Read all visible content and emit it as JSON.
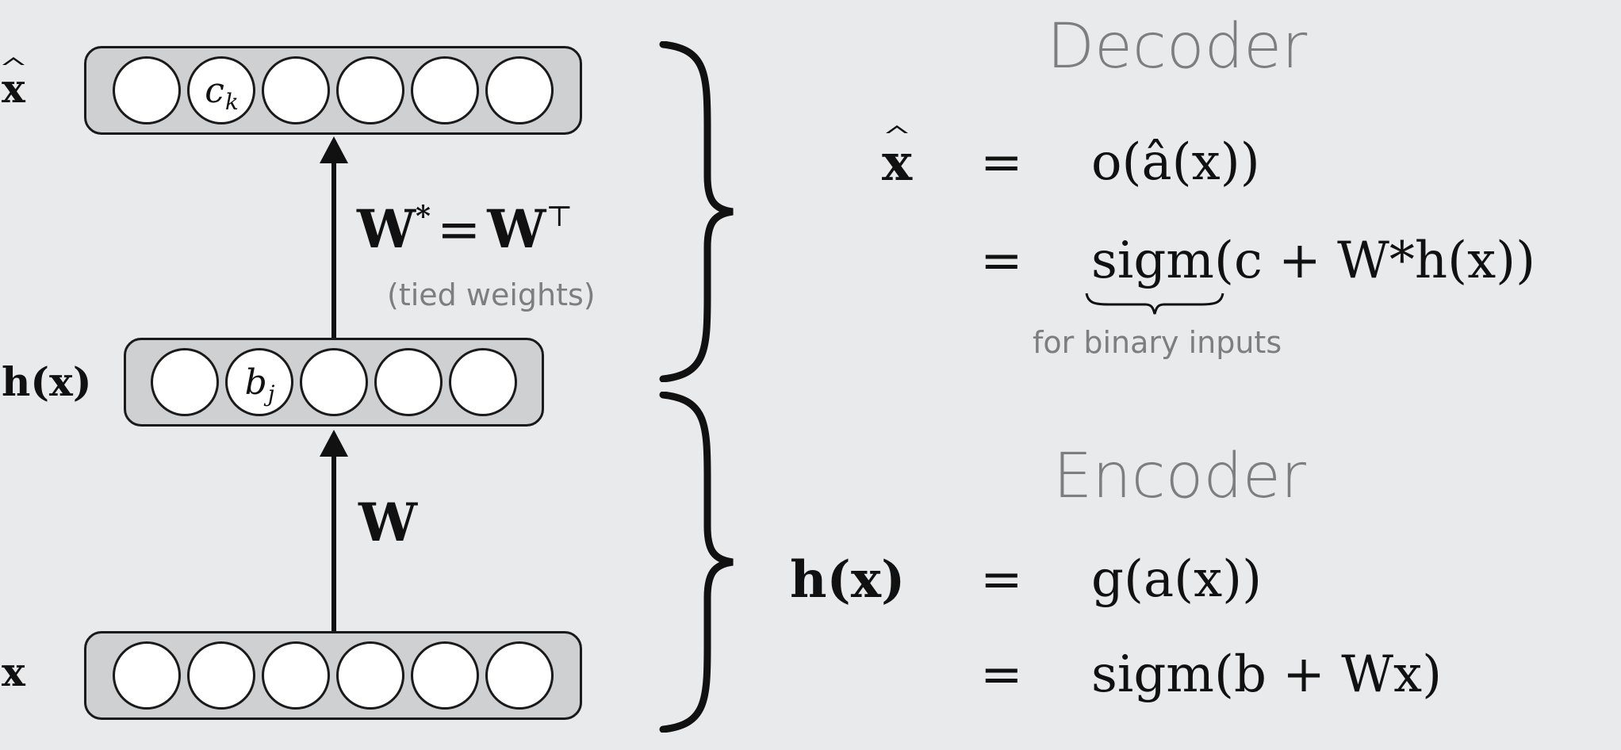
{
  "layers": {
    "output": {
      "label": "x̂",
      "labelBold": "x",
      "units": [
        "",
        "c_k",
        "",
        "",
        "",
        ""
      ],
      "unit_label": "c",
      "unit_sub": "k"
    },
    "hidden": {
      "label": "h(x)",
      "units": [
        "",
        "b_j",
        "",
        "",
        ""
      ],
      "unit_label": "b",
      "unit_sub": "j"
    },
    "input": {
      "label": "x",
      "units": [
        "",
        "",
        "",
        "",
        "",
        ""
      ]
    }
  },
  "weights": {
    "decoder_label_W": "W",
    "decoder_star": "*",
    "decoder_eq": "=",
    "decoder_WT": "W",
    "decoder_T": "⊤",
    "decoder_note": "(tied weights)",
    "encoder_label": "W"
  },
  "decoder": {
    "title": "Decoder",
    "line1": {
      "lhs": "x",
      "eq": "=",
      "rhs": "o(â(x))"
    },
    "line2": {
      "eq": "=",
      "func": "sigm",
      "rhs": "(c + W*h(x))"
    },
    "note": "for binary inputs"
  },
  "encoder": {
    "title": "Encoder",
    "line1": {
      "lhs": "h(x)",
      "eq": "=",
      "rhs": "g(a(x))"
    },
    "line2": {
      "eq": "=",
      "rhs": "sigm(b + Wx)"
    }
  },
  "colors": {
    "background": "#e9eaec",
    "layer_fill": "#cfd0d2",
    "gray_text": "#7d7e80"
  }
}
